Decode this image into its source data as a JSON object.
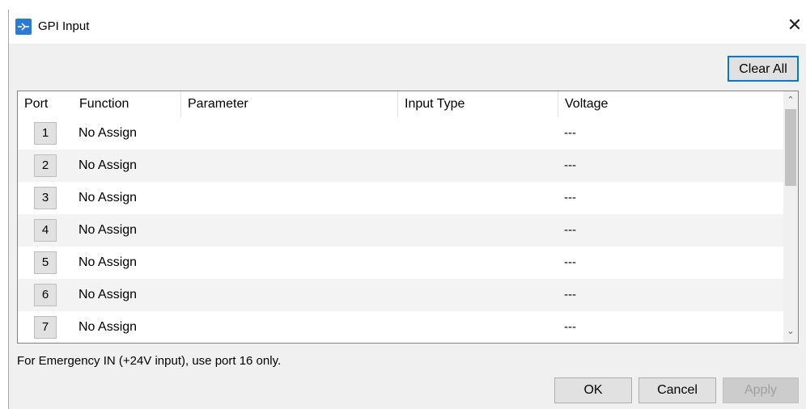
{
  "window": {
    "title": "GPI Input",
    "close_glyph": "✕"
  },
  "toolbar": {
    "clear_all_label": "Clear All"
  },
  "table": {
    "columns": {
      "port": "Port",
      "function": "Function",
      "parameter": "Parameter",
      "input_type": "Input Type",
      "voltage": "Voltage"
    },
    "rows": [
      {
        "port": "1",
        "function": "No Assign",
        "parameter": "",
        "input_type": "",
        "voltage": "---"
      },
      {
        "port": "2",
        "function": "No Assign",
        "parameter": "",
        "input_type": "",
        "voltage": "---"
      },
      {
        "port": "3",
        "function": "No Assign",
        "parameter": "",
        "input_type": "",
        "voltage": "---"
      },
      {
        "port": "4",
        "function": "No Assign",
        "parameter": "",
        "input_type": "",
        "voltage": "---"
      },
      {
        "port": "5",
        "function": "No Assign",
        "parameter": "",
        "input_type": "",
        "voltage": "---"
      },
      {
        "port": "6",
        "function": "No Assign",
        "parameter": "",
        "input_type": "",
        "voltage": "---"
      },
      {
        "port": "7",
        "function": "No Assign",
        "parameter": "",
        "input_type": "",
        "voltage": "---"
      }
    ]
  },
  "note": "For Emergency IN (+24V input), use port 16 only.",
  "footer": {
    "ok_label": "OK",
    "cancel_label": "Cancel",
    "apply_label": "Apply"
  },
  "icons": {
    "app": "gpi-app-icon",
    "close": "close-icon",
    "scroll_up": "chevron-up-icon",
    "scroll_down": "chevron-down-icon"
  },
  "colors": {
    "accent": "#0078d7",
    "app_icon": "#2b7bd6",
    "disabled_text": "#a0a0a0"
  }
}
